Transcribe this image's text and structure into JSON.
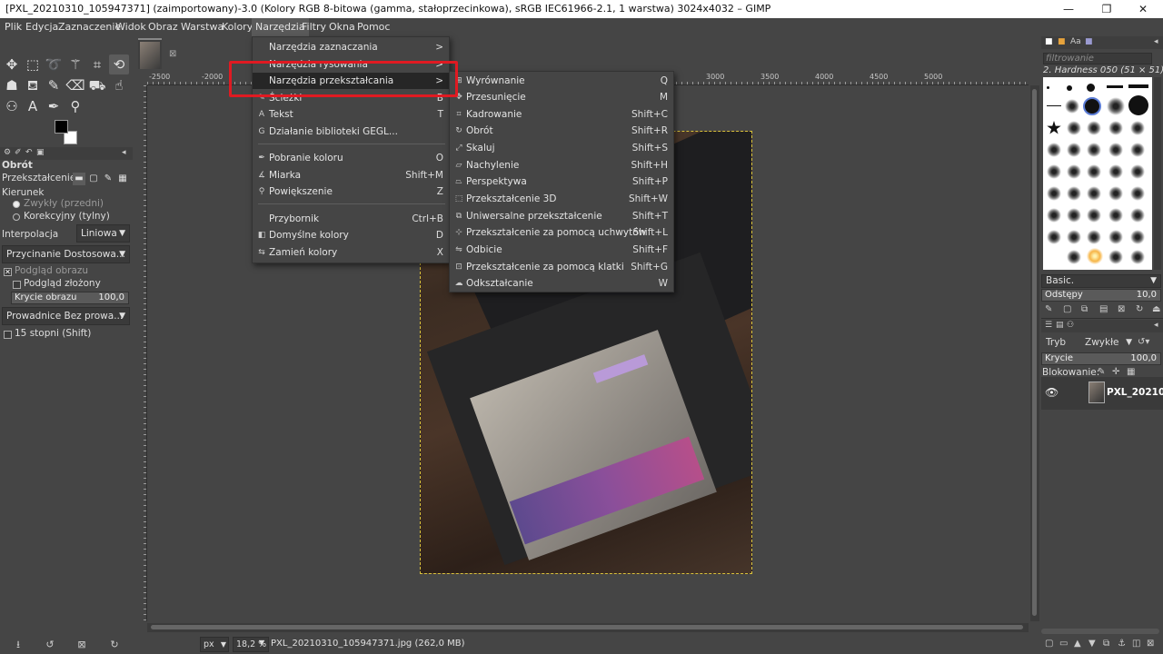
{
  "window": {
    "title": "[PXL_20210310_105947371] (zaimportowany)-3.0 (Kolory RGB 8-bitowa (gamma, stałoprzecinkowa), sRGB IEC61966-2.1, 1 warstwa) 3024x4032 – GIMP",
    "minimize": "—",
    "maximize": "❐",
    "close": "✕"
  },
  "menubar": [
    "Plik",
    "Edycja",
    "Zaznaczenie",
    "Widok",
    "Obraz",
    "Warstwa",
    "Kolory",
    "Narzędzia",
    "Filtry",
    "Okna",
    "Pomoc"
  ],
  "tools_menu": {
    "items": [
      {
        "label": "Narzędzia zaznaczania",
        "shortcut": ">",
        "icon": ""
      },
      {
        "label": "Narzędzia rysowania",
        "shortcut": ">",
        "icon": ""
      },
      {
        "label": "Narzędzia przekształcania",
        "shortcut": ">",
        "icon": ""
      },
      {
        "label": "Ścieżki",
        "shortcut": "B",
        "icon": "✎"
      },
      {
        "label": "Tekst",
        "shortcut": "T",
        "icon": "A"
      },
      {
        "label": "Działanie biblioteki GEGL...",
        "shortcut": "",
        "icon": "G"
      },
      {
        "label": "Pobranie koloru",
        "shortcut": "O",
        "icon": "✒"
      },
      {
        "label": "Miarka",
        "shortcut": "Shift+M",
        "icon": "∡"
      },
      {
        "label": "Powiększenie",
        "shortcut": "Z",
        "icon": "⚲"
      },
      {
        "label": "Przybornik",
        "shortcut": "Ctrl+B",
        "icon": ""
      },
      {
        "label": "Domyślne kolory",
        "shortcut": "D",
        "icon": "◧"
      },
      {
        "label": "Zamień kolory",
        "shortcut": "X",
        "icon": "⇆"
      }
    ]
  },
  "transform_menu": {
    "items": [
      {
        "label": "Wyrównanie",
        "shortcut": "Q",
        "icon": "⊞"
      },
      {
        "label": "Przesunięcie",
        "shortcut": "M",
        "icon": "✥"
      },
      {
        "label": "Kadrowanie",
        "shortcut": "Shift+C",
        "icon": "⌗"
      },
      {
        "label": "Obrót",
        "shortcut": "Shift+R",
        "icon": "↻"
      },
      {
        "label": "Skaluj",
        "shortcut": "Shift+S",
        "icon": "⤢"
      },
      {
        "label": "Nachylenie",
        "shortcut": "Shift+H",
        "icon": "▱"
      },
      {
        "label": "Perspektywa",
        "shortcut": "Shift+P",
        "icon": "⏢"
      },
      {
        "label": "Przekształcenie 3D",
        "shortcut": "Shift+W",
        "icon": "⬚"
      },
      {
        "label": "Uniwersalne przekształcenie",
        "shortcut": "Shift+T",
        "icon": "⧉"
      },
      {
        "label": "Przekształcenie za pomocą uchwytów",
        "shortcut": "Shift+L",
        "icon": "⊹"
      },
      {
        "label": "Odbicie",
        "shortcut": "Shift+F",
        "icon": "⇋"
      },
      {
        "label": "Przekształcenie za pomocą klatki",
        "shortcut": "Shift+G",
        "icon": "⊡"
      },
      {
        "label": "Odkształcanie",
        "shortcut": "W",
        "icon": "☁"
      }
    ]
  },
  "tool_options": {
    "title": "Obrót",
    "transform_label": "Przekształcenie:",
    "direction_label": "Kierunek",
    "direction_normal": "Zwykły (przedni)",
    "direction_corrective": "Korekcyjny (tylny)",
    "interpolation_label": "Interpolacja",
    "interpolation_value": "Liniowa",
    "clipping_value": "Przycinanie Dostosowa...",
    "preview_image": "Podgląd obrazu",
    "preview_composite": "Podgląd złożony",
    "image_opacity_label": "Krycie obrazu",
    "image_opacity_value": "100,0",
    "guides_value": "Prowadnice Bez prowa...",
    "constrain_label": "15 stopni (Shift)"
  },
  "rulers": {
    "top": [
      "-2500",
      "-2000",
      "3000",
      "3500",
      "4000",
      "4500",
      "5000"
    ]
  },
  "statusbar": {
    "unit": "px",
    "zoom": "18,2 %",
    "file_info": "PXL_20210310_105947371.jpg (262,0 MB)"
  },
  "brushes": {
    "filter_placeholder": "filtrowanie",
    "current_brush": "2. Hardness 050 (51 × 51)",
    "preset": "Basic.",
    "spacing_label": "Odstępy",
    "spacing_value": "10,0"
  },
  "layers": {
    "mode_label": "Tryb",
    "mode_value": "Zwykłe",
    "opacity_label": "Krycie",
    "opacity_value": "100,0",
    "lock_label": "Blokowanie:",
    "layer_name": "PXL_20210"
  },
  "colors": {
    "highlight": "#e01a22",
    "selection_outline": "#d8c23b"
  }
}
